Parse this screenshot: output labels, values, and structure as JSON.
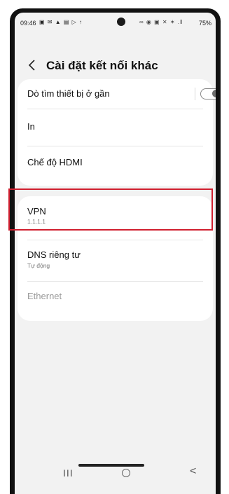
{
  "status_bar": {
    "time": "09:46",
    "left_icons": "▣ ✉ ▲ ▤ ▷ ↑",
    "right_icons": "∞ ◉ ▣ ✕ ✶ .‖",
    "battery": "75%"
  },
  "header": {
    "title": "Cài đặt kết nối khác"
  },
  "card1": {
    "nearby": {
      "label": "Dò tìm thiết bị ở gần",
      "toggle_on": false
    },
    "print": {
      "label": "In"
    },
    "hdmi": {
      "label": "Chế độ HDMI"
    }
  },
  "card2": {
    "vpn": {
      "label": "VPN",
      "value": "1.1.1.1"
    },
    "dns": {
      "label": "DNS riêng tư",
      "value": "Tự động"
    },
    "ethernet": {
      "label": "Ethernet"
    }
  },
  "nav": {
    "recent": "III",
    "back": "<"
  },
  "colors": {
    "highlight": "#d11f2f",
    "background": "#f2f2f2",
    "disabled_text": "#9a9a9a"
  }
}
